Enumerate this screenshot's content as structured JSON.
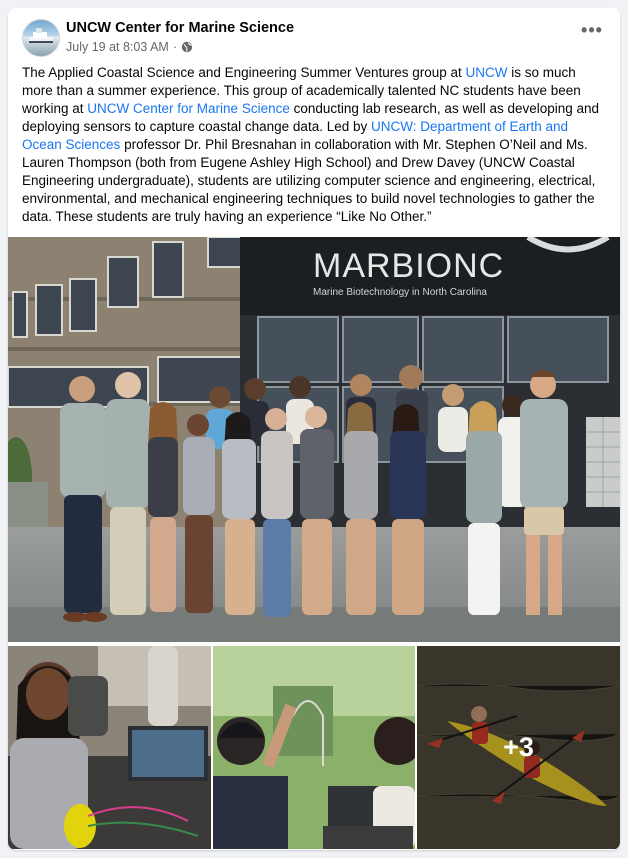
{
  "post": {
    "page_name": "UNCW Center for Marine Science",
    "timestamp": "July 19 at 8:03 AM",
    "separator": "·",
    "audience_icon": "globe-icon",
    "more_icon": "more-options-icon",
    "more_label": "•••",
    "text": {
      "p1": "The Applied Coastal Science and Engineering Summer Ventures group at ",
      "link1": "UNCW",
      "p2": " is so much more than a summer experience. This group of academically talented NC students have been working at ",
      "link2": "UNCW Center for Marine Science",
      "p3": "  conducting lab research, as well as developing and deploying sensors to capture coastal change data. Led by ",
      "link3": "UNCW: Department of Earth and Ocean Sciences",
      "p4": "  professor Dr. Phil Bresnahan in collaboration with Mr. Stephen O’Neil and Ms. Lauren Thompson (both from Eugene Ashley High School) and Drew Davey (UNCW Coastal Engineering undergraduate), students are utilizing computer science and engineering, electrical, environmental, and mechanical engineering techniques to build novel technologies to gather the data. These students are truly having an experience “Like No Other.”"
    },
    "photos": {
      "main_sign": "MARBIONC",
      "main_sign_sub": "Marine Biotechnology in North Carolina",
      "more_count": "+3"
    }
  },
  "colors": {
    "link": "#1877f2",
    "secondary_text": "#65676b",
    "background": "#f0f2f5"
  }
}
